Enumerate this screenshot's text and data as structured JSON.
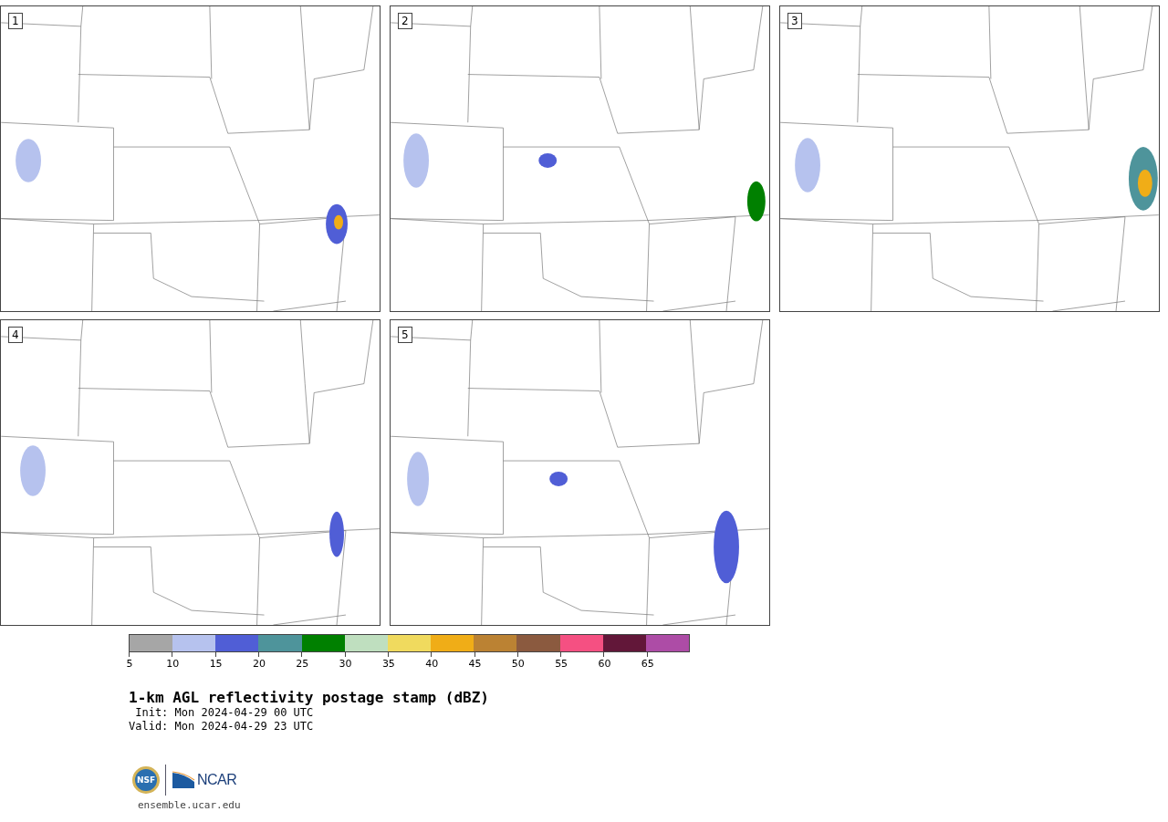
{
  "panels": [
    {
      "label": "1"
    },
    {
      "label": "2"
    },
    {
      "label": "3"
    },
    {
      "label": "4"
    },
    {
      "label": "5"
    }
  ],
  "colorbar": {
    "segments": [
      {
        "color": "#a6a6a6"
      },
      {
        "color": "#b6c2ee"
      },
      {
        "color": "#505ed6"
      },
      {
        "color": "#4e949b"
      },
      {
        "color": "#008000"
      },
      {
        "color": "#bfdfbf"
      },
      {
        "color": "#f0da5e"
      },
      {
        "color": "#f0ad17"
      },
      {
        "color": "#bb8233"
      },
      {
        "color": "#8b5a3f"
      },
      {
        "color": "#f55082"
      },
      {
        "color": "#621739"
      },
      {
        "color": "#ad4ca6"
      }
    ],
    "ticks": [
      "5",
      "10",
      "15",
      "20",
      "25",
      "30",
      "35",
      "40",
      "45",
      "50",
      "55",
      "60",
      "65"
    ]
  },
  "title": "1-km AGL reflectivity postage stamp (dBZ)",
  "init": " Init: Mon 2024-04-29 00 UTC",
  "valid": "Valid: Mon 2024-04-29 23 UTC",
  "logos": {
    "nsf": "NSF",
    "ncar": "NCAR"
  },
  "url": "ensemble.ucar.edu"
}
